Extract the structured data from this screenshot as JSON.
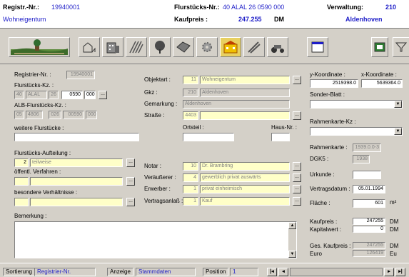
{
  "header": {
    "registr_label": "Registr.-Nr.:",
    "registr_value": "19940001",
    "type_value": "Wohneigentum",
    "flurstueck_label": "Flurstücks-Nr.:",
    "flurstueck_value": "40 ALAL 26 0590 000",
    "kaufpreis_label": "Kaufpreis :",
    "kaufpreis_value": "247.255",
    "kaufpreis_unit": "DM",
    "verwaltung_label": "Verwaltung:",
    "verwaltung_value": "210",
    "ort_value": "Aldenhoven"
  },
  "toolbar": {
    "buttons": [
      "landscape-icon",
      "chart-house-icon",
      "building-icon",
      "field-icon",
      "tree-icon",
      "plot-icon",
      "gear-icon",
      "village-icon",
      "crops-icon",
      "tractor-icon",
      "window-icon",
      "picture-icon",
      "funnel-icon"
    ]
  },
  "form": {
    "registrier_label": "Registrier-Nr. :",
    "registrier_value": "19940001",
    "flurstuecks_kz_label": "Flurstücks-Kz. :",
    "fkz": [
      "40",
      "ALAL",
      "26",
      "0590",
      "000"
    ],
    "alb_label": "ALB-Flurstücks-Kz. :",
    "alb": [
      "05",
      "4806",
      "026",
      "00590",
      "000"
    ],
    "weitere_label": "weitere Flurstücke :",
    "objektart_label": "Objektart :",
    "objektart_code": "11",
    "objektart_value": "Wohneigentum",
    "gkz_label": "Gkz :",
    "gkz_code": "210",
    "gkz_value": "Aldenhoven",
    "gemarkung_label": "Gemarkung :",
    "gemarkung_value": "Aldenhoven",
    "strasse_label": "Straße :",
    "strasse_code": "4403",
    "strasse_value": "",
    "ortsteil_label": "Ortsteil :",
    "hausnr_label": "Haus-Nr. :",
    "y_koord_label": "y-Koordinate :",
    "y_koord_value": "2519398.0",
    "x_koord_label": "x-Koordinate :",
    "x_koord_value": "5639364.0",
    "sonderblatt_label": "Sonder-Blatt :",
    "rahmenkarte_kz_label": "Rahmenkarte-Kz :",
    "rahmenkarte_label": "Rahmenkarte :",
    "rahmenkarte_value": "1939.0.0-3",
    "dgk5_label": "DGK5 :",
    "dgk5_value": "1938",
    "aufteilung_label": "Flurstücks-Aufteilung :",
    "aufteilung_code": "2",
    "aufteilung_value": "teilweise",
    "verfahren_label": "öffentl. Verfahren :",
    "verhaeltnisse_label": "besondere Verhältnisse :",
    "notar_label": "Notar :",
    "notar_code": "10",
    "notar_value": "Dr. Brambring",
    "veraeusserer_label": "Veräußerer :",
    "veraeusserer_code": "4",
    "veraeusserer_value": "gewerblich privat auswärts",
    "erwerber_label": "Erwerber :",
    "erwerber_code": "1",
    "erwerber_value": "privat einheimisch",
    "vertragsanlass_label": "Vertragsanlaß :",
    "vertragsanlass_code": "1",
    "vertragsanlass_value": "Kauf",
    "urkunde_label": "Urkunde :",
    "vertragsdatum_label": "Vertragsdatum :",
    "vertragsdatum_value": "05.01.1994",
    "flaeche_label": "Fläche :",
    "flaeche_value": "601",
    "flaeche_unit": "m²",
    "bemerkung_label": "Bemerkung :",
    "kaufpreis_label": "Kaufpreis :",
    "kaufpreis_value": "247255",
    "kapitalwert_label": "Kapitalwert :",
    "kapitalwert_value": "0",
    "ges_kaufpreis_label": "Ges. Kaufpreis :",
    "ges_kaufpreis_value": "247255",
    "euro_label": "Euro",
    "euro_value": "126419",
    "unit_dm": "DM",
    "unit_eu": "Eu"
  },
  "status": {
    "sortierung_label": "Sortierung",
    "sortierung_value": "Registrier-Nr.",
    "anzeige_label": "Anzeige",
    "anzeige_value": "Stammdaten",
    "position_label": "Position",
    "position_value": "1"
  }
}
